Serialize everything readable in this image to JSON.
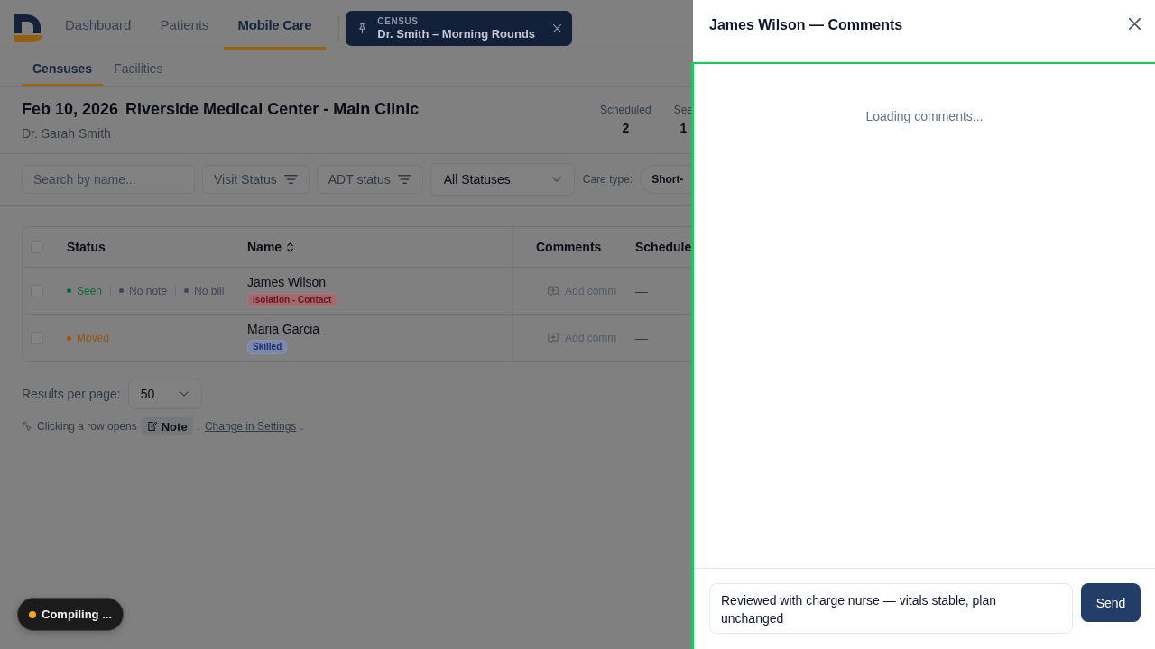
{
  "app": {
    "nav": {
      "tabs": [
        {
          "label": "Dashboard",
          "selected": false
        },
        {
          "label": "Patients",
          "selected": false
        },
        {
          "label": "Mobile Care",
          "selected": true
        }
      ],
      "census_chip": {
        "label": "CENSUS",
        "title": "Dr. Smith – Morning Rounds"
      }
    },
    "subtabs": [
      {
        "label": "Censuses",
        "selected": true
      },
      {
        "label": "Facilities",
        "selected": false
      }
    ],
    "header": {
      "date": "Feb 10, 2026",
      "facility": "Riverside Medical Center - Main Clinic",
      "provider": "Dr. Sarah Smith",
      "stats": [
        {
          "label": "Scheduled",
          "value": "2"
        },
        {
          "label": "See",
          "value": "1"
        }
      ]
    },
    "filters": {
      "search": {
        "placeholder": "Search by name..."
      },
      "filter_buttons": [
        "Visit Status",
        "ADT status"
      ],
      "status_select": {
        "value": "All Statuses"
      },
      "care_type": {
        "label": "Care type:",
        "chip": "Short-"
      }
    },
    "table": {
      "all_checked": false,
      "columns": [
        {
          "label": "Status",
          "sortable": false
        },
        {
          "label": "Name",
          "sortable": true
        },
        {
          "label": "Comments",
          "sortable": false
        },
        {
          "label": "Schedule",
          "sortable": false
        }
      ],
      "rows": [
        {
          "checked": false,
          "statuses": [
            {
              "label": "Seen",
              "color": "#12683c"
            },
            {
              "label": "No note",
              "color": "#3f4654"
            },
            {
              "label": "No bill",
              "color": "#3f4654"
            }
          ],
          "name": "James Wilson",
          "tag": {
            "label": "Isolation - Contact",
            "kind": "alert"
          },
          "comment_action": "Add comm",
          "schedule": "—"
        },
        {
          "checked": false,
          "statuses": [
            {
              "label": "Moved",
              "color": "#96560f"
            }
          ],
          "name": "Maria Garcia",
          "tag": {
            "label": "Skilled",
            "kind": "info"
          },
          "comment_action": "Add comm",
          "schedule": "—"
        }
      ]
    },
    "pagination": {
      "label": "Results per page:",
      "value": "50"
    },
    "hint": {
      "text": "Clicking a row opens",
      "chip": "Note",
      "separator": ".",
      "link": "Change in Settings",
      "end": "."
    }
  },
  "drawer": {
    "title": "James Wilson — Comments",
    "loading_text": "Loading comments...",
    "composer": {
      "value": "Reviewed with charge nurse — vitals stable, plan unchanged"
    },
    "send_label": "Send"
  },
  "dev_indicator": {
    "label": "Compiling ..."
  }
}
